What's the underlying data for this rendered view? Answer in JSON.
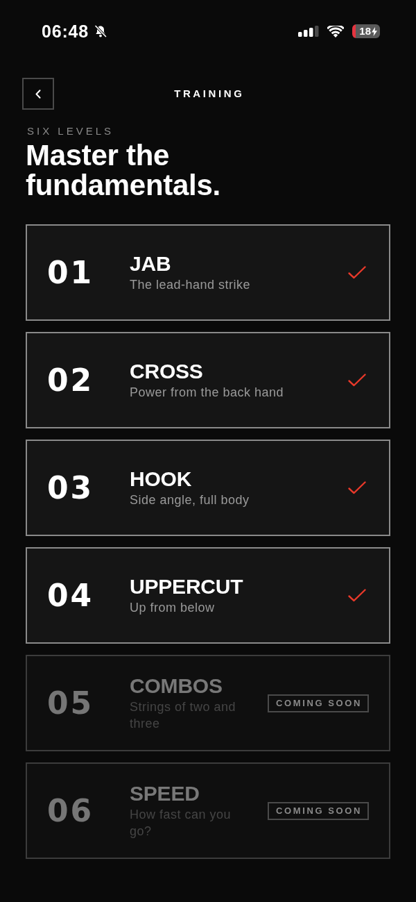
{
  "status_bar": {
    "time": "06:48",
    "battery": "18"
  },
  "nav": {
    "title": "TRAINING"
  },
  "header": {
    "eyebrow": "SIX LEVELS",
    "title": "Master the fundamentals."
  },
  "levels": [
    {
      "kind": "completed",
      "number": "01",
      "name": "JAB",
      "description": "The lead-hand strike"
    },
    {
      "kind": "completed",
      "number": "02",
      "name": "CROSS",
      "description": "Power from the back hand"
    },
    {
      "kind": "completed",
      "number": "03",
      "name": "HOOK",
      "description": "Side angle, full body"
    },
    {
      "kind": "completed",
      "number": "04",
      "name": "UPPERCUT",
      "description": "Up from below"
    },
    {
      "kind": "coming_soon",
      "number": "05",
      "name": "COMBOS",
      "description": "Strings of two and three",
      "badge": "COMING SOON"
    },
    {
      "kind": "coming_soon",
      "number": "06",
      "name": "SPEED",
      "description": "How fast can you go?",
      "badge": "COMING SOON"
    }
  ]
}
